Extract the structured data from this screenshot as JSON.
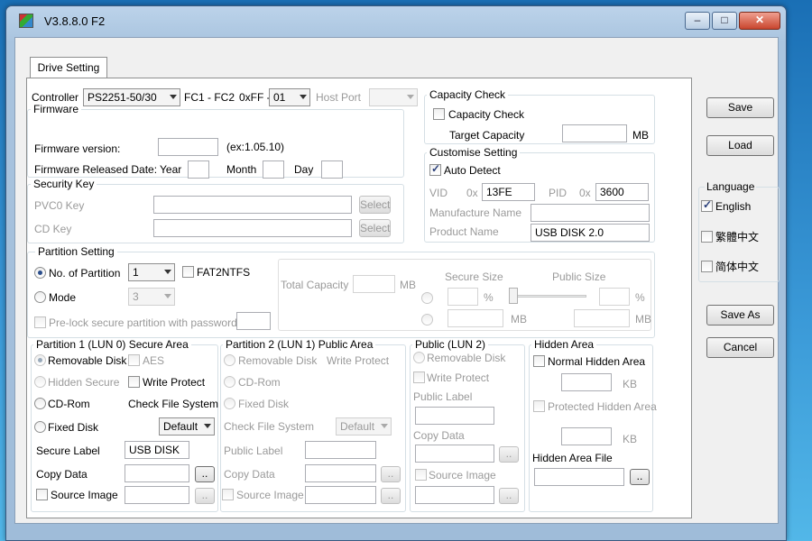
{
  "window": {
    "title": "V3.8.8.0 F2"
  },
  "tabs": [
    {
      "label": "Drive Setting"
    }
  ],
  "controller": {
    "label": "Controller",
    "value": "PS2251-50/30",
    "fc_label": "FC1 - FC2",
    "xff_label": "0xFF -",
    "xff_value": "01",
    "host_port_label": "Host Port",
    "host_port_value": ""
  },
  "firmware": {
    "title": "Firmware",
    "version_label": "Firmware version:",
    "version_value": "",
    "example": "(ex:1.05.10)",
    "date_label": "Firmware Released Date:",
    "year_label": "Year",
    "month_label": "Month",
    "day_label": "Day"
  },
  "security": {
    "title": "Security Key",
    "pvc0_label": "PVC0 Key",
    "cd_label": "CD Key",
    "select_label": "Select"
  },
  "capacity": {
    "title": "Capacity Check",
    "check_label": "Capacity Check",
    "target_label": "Target Capacity",
    "unit": "MB",
    "checked": false
  },
  "customise": {
    "title": "Customise Setting",
    "auto_detect_label": "Auto Detect",
    "auto_detect_checked": true,
    "vid_label": "VID",
    "pid_label": "PID",
    "hex_prefix": "0x",
    "vid_value": "13FE",
    "pid_value": "3600",
    "manufacture_label": "Manufacture Name",
    "manufacture_value": "",
    "product_label": "Product Name",
    "product_value": "USB DISK 2.0"
  },
  "partition": {
    "title": "Partition Setting",
    "no_label": "No. of Partition",
    "no_value": "1",
    "fat_label": "FAT2NTFS",
    "mode_label": "Mode",
    "mode_value": "3",
    "prelock_label": "Pre-lock secure partition with password :",
    "total_label": "Total Capacity",
    "mb": "MB",
    "secure_size_label": "Secure Size",
    "public_size_label": "Public Size",
    "percent": "%"
  },
  "lun0": {
    "title": "Partition 1 (LUN 0) Secure Area",
    "removable": "Removable Disk",
    "aes": "AES",
    "hidden_secure": "Hidden Secure",
    "write_protect": "Write Protect",
    "cdrom": "CD-Rom",
    "check_fs": "Check File System",
    "fixed": "Fixed Disk",
    "fs_value": "Default",
    "secure_label": "Secure Label",
    "secure_label_value": "USB DISK",
    "copy_data": "Copy Data",
    "source_image": "Source Image",
    "browse": ".."
  },
  "lun1": {
    "title": "Partition 2 (LUN 1) Public Area",
    "removable": "Removable Disk",
    "write_protect": "Write Protect",
    "cdrom": "CD-Rom",
    "fixed": "Fixed Disk",
    "check_fs": "Check File System",
    "fs_value": "Default",
    "public_label": "Public Label",
    "copy_data": "Copy Data",
    "source_image": "Source Image",
    "browse": ".."
  },
  "lun2": {
    "title": "Public (LUN 2)",
    "removable": "Removable Disk",
    "write_protect": "Write Protect",
    "public_label": "Public Label",
    "copy_data": "Copy Data",
    "source_image": "Source Image",
    "browse": ".."
  },
  "hidden": {
    "title": "Hidden Area",
    "normal": "Normal Hidden Area",
    "kb": "KB",
    "protected": "Protected Hidden Area",
    "file_label": "Hidden Area File",
    "browse": ".."
  },
  "side_buttons": {
    "save": "Save",
    "load": "Load",
    "save_as": "Save As",
    "cancel": "Cancel"
  },
  "language": {
    "title": "Language",
    "options": [
      {
        "label": "English",
        "checked": true
      },
      {
        "label": "繁體中文",
        "checked": false
      },
      {
        "label": "简体中文",
        "checked": false
      }
    ]
  }
}
